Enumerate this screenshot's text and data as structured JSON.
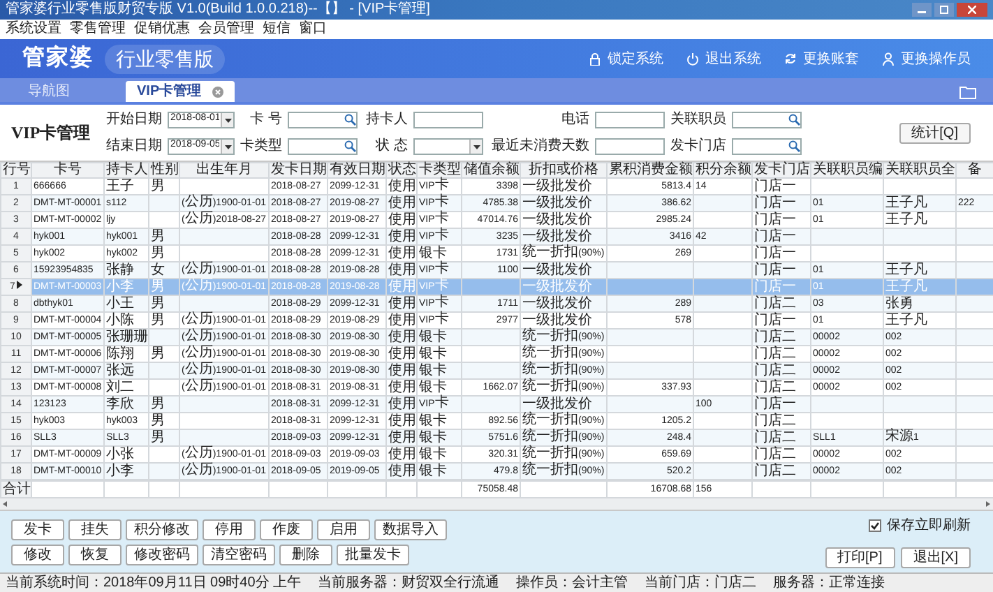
{
  "window": {
    "title": "管家婆行业零售版财贸专版 V1.0(Build 1.0.0.218)--【】 - [VIP卡管理]"
  },
  "menu": [
    "系统设置",
    "零售管理",
    "促销优惠",
    "会员管理",
    "短信",
    "窗口"
  ],
  "banner": {
    "logo": "管家婆",
    "edition": "行业零售版",
    "actions": [
      {
        "kind": "lock",
        "label": "锁定系统"
      },
      {
        "kind": "power",
        "label": "退出系统"
      },
      {
        "kind": "refresh",
        "label": "更换账套"
      },
      {
        "kind": "user",
        "label": "更换操作员"
      }
    ]
  },
  "tabs": [
    {
      "label": "导航图",
      "selected": false
    },
    {
      "label": "VIP卡管理",
      "selected": true
    }
  ],
  "filter": {
    "title": "VIP卡管理",
    "fields": [
      {
        "label": "开始日期",
        "kind": "date",
        "value": "2018-08-01"
      },
      {
        "label": "卡 号",
        "kind": "search"
      },
      {
        "label": "持卡人",
        "kind": "text"
      },
      {
        "label": "电话",
        "kind": "text"
      },
      {
        "label": "关联职员",
        "kind": "search"
      },
      {
        "label": "结束日期",
        "kind": "date",
        "value": "2018-09-05"
      },
      {
        "label": "卡类型",
        "kind": "search"
      },
      {
        "label": "状 态",
        "kind": "select"
      },
      {
        "label": "最近未消费天数",
        "kind": "text"
      },
      {
        "label": "发卡门店",
        "kind": "search"
      }
    ],
    "stats_button": "统计[Q]"
  },
  "table": {
    "columns": [
      {
        "label": "行号"
      },
      {
        "label": "卡号"
      },
      {
        "label": "持卡人"
      },
      {
        "label": "性别"
      },
      {
        "label": "出生年月"
      },
      {
        "label": "发卡日期"
      },
      {
        "label": "有效日期"
      },
      {
        "label": "状态"
      },
      {
        "label": "卡类型"
      },
      {
        "label": "储值余额",
        "numeric": true
      },
      {
        "label": "折扣或价格"
      },
      {
        "label": "累积消费金额",
        "numeric": true
      },
      {
        "label": "积分余额"
      },
      {
        "label": "发卡门店"
      },
      {
        "label": "关联职员编"
      },
      {
        "label": "关联职员全"
      },
      {
        "label": "备"
      }
    ],
    "rows": [
      {
        "selected": false,
        "cells": [
          "1",
          "666666",
          "王子",
          "男",
          null,
          "2018-08-27",
          "2099-12-31",
          "使用",
          "VIP卡",
          "3398",
          "一级批发价",
          "5813.4",
          "14",
          "门店一",
          null,
          null,
          null
        ]
      },
      {
        "selected": false,
        "cells": [
          "2",
          "DMT-MT-00001",
          "s112",
          null,
          "(公历)1900-01-01",
          "2018-08-27",
          "2019-08-27",
          "使用",
          "VIP卡",
          "4785.38",
          "一级批发价",
          "386.62",
          null,
          "门店一",
          "01",
          "王子凡",
          "222"
        ]
      },
      {
        "selected": false,
        "cells": [
          "3",
          "DMT-MT-00002",
          "ljy",
          null,
          "(公历)2018-08-27",
          "2018-08-27",
          "2019-08-27",
          "使用",
          "VIP卡",
          "47014.76",
          "一级批发价",
          "2985.24",
          null,
          "门店一",
          "01",
          "王子凡",
          null
        ]
      },
      {
        "selected": false,
        "cells": [
          "4",
          "hyk001",
          "hyk001",
          "男",
          null,
          "2018-08-28",
          "2099-12-31",
          "使用",
          "VIP卡",
          "3235",
          "一级批发价",
          "3416",
          "42",
          "门店一",
          null,
          null,
          null
        ]
      },
      {
        "selected": false,
        "cells": [
          "5",
          "hyk002",
          "hyk002",
          "男",
          null,
          "2018-08-28",
          "2099-12-31",
          "使用",
          "银卡",
          "1731",
          "统一折扣(90%)",
          "269",
          null,
          "门店一",
          null,
          null,
          null
        ]
      },
      {
        "selected": false,
        "cells": [
          "6",
          "15923954835",
          "张静",
          "女",
          "(公历)1900-01-01",
          "2018-08-28",
          "2019-08-28",
          "使用",
          "VIP卡",
          "1100",
          "一级批发价",
          null,
          null,
          "门店一",
          "01",
          "王子凡",
          null
        ]
      },
      {
        "selected": true,
        "cells": [
          "7",
          "DMT-MT-00003",
          "小李",
          "男",
          "(公历)1900-01-01",
          "2018-08-28",
          "2019-08-28",
          "使用",
          "VIP卡",
          null,
          "一级批发价",
          null,
          null,
          "门店一",
          "01",
          "王子凡",
          null
        ]
      },
      {
        "selected": false,
        "cells": [
          "8",
          "dbthyk01",
          "小王",
          "男",
          null,
          "2018-08-29",
          "2099-12-31",
          "使用",
          "VIP卡",
          "1711",
          "一级批发价",
          "289",
          null,
          "门店二",
          "03",
          "张勇",
          null
        ]
      },
      {
        "selected": false,
        "cells": [
          "9",
          "DMT-MT-00004",
          "小陈",
          "男",
          "(公历)1900-01-01",
          "2018-08-29",
          "2019-08-29",
          "使用",
          "VIP卡",
          "2977",
          "一级批发价",
          "578",
          null,
          "门店一",
          "01",
          "王子凡",
          null
        ]
      },
      {
        "selected": false,
        "cells": [
          "10",
          "DMT-MT-00005",
          "张珊珊",
          null,
          "(公历)1900-01-01",
          "2018-08-30",
          "2019-08-30",
          "使用",
          "银卡",
          null,
          "统一折扣(90%)",
          null,
          null,
          "门店二",
          "00002",
          "002",
          null
        ]
      },
      {
        "selected": false,
        "cells": [
          "11",
          "DMT-MT-00006",
          "陈翔",
          "男",
          "(公历)1900-01-01",
          "2018-08-30",
          "2019-08-30",
          "使用",
          "银卡",
          null,
          "统一折扣(90%)",
          null,
          null,
          "门店二",
          "00002",
          "002",
          null
        ]
      },
      {
        "selected": false,
        "cells": [
          "12",
          "DMT-MT-00007",
          "张远",
          null,
          "(公历)1900-01-01",
          "2018-08-30",
          "2019-08-30",
          "使用",
          "银卡",
          null,
          "统一折扣(90%)",
          null,
          null,
          "门店二",
          "00002",
          "002",
          null
        ]
      },
      {
        "selected": false,
        "cells": [
          "13",
          "DMT-MT-00008",
          "刘二",
          null,
          "(公历)1900-01-01",
          "2018-08-31",
          "2019-08-31",
          "使用",
          "银卡",
          "1662.07",
          "统一折扣(90%)",
          "337.93",
          null,
          "门店二",
          "00002",
          "002",
          null
        ]
      },
      {
        "selected": false,
        "cells": [
          "14",
          "123123",
          "李欣",
          "男",
          null,
          "2018-08-31",
          "2099-12-31",
          "使用",
          "VIP卡",
          null,
          "一级批发价",
          null,
          "100",
          "门店一",
          null,
          null,
          null
        ]
      },
      {
        "selected": false,
        "cells": [
          "15",
          "hyk003",
          "hyk003",
          "男",
          null,
          "2018-08-31",
          "2099-12-31",
          "使用",
          "银卡",
          "892.56",
          "统一折扣(90%)",
          "1205.2",
          null,
          "门店二",
          null,
          null,
          null
        ]
      },
      {
        "selected": false,
        "cells": [
          "16",
          "SLL3",
          "SLL3",
          "男",
          null,
          "2018-09-03",
          "2099-12-31",
          "使用",
          "银卡",
          "5751.6",
          "统一折扣(90%)",
          "248.4",
          null,
          "门店二",
          "SLL1",
          "宋源1",
          null
        ]
      },
      {
        "selected": false,
        "cells": [
          "17",
          "DMT-MT-00009",
          "小张",
          null,
          "(公历)1900-01-01",
          "2018-09-03",
          "2019-09-03",
          "使用",
          "银卡",
          "320.31",
          "统一折扣(90%)",
          "659.69",
          null,
          "门店二",
          "00002",
          "002",
          null
        ]
      },
      {
        "selected": false,
        "cells": [
          "18",
          "DMT-MT-00010",
          "小李",
          null,
          "(公历)1900-01-01",
          "2018-09-05",
          "2019-09-05",
          "使用",
          "银卡",
          "479.8",
          "统一折扣(90%)",
          "520.2",
          null,
          "门店二",
          "00002",
          "002",
          null
        ]
      }
    ],
    "total": {
      "label": "合计",
      "cells": [
        null,
        null,
        null,
        null,
        null,
        null,
        null,
        null,
        "75058.48",
        null,
        "16708.68",
        "156",
        null,
        null,
        null,
        null
      ]
    }
  },
  "actions": {
    "row_1": [
      "发卡",
      "挂失",
      "积分修改",
      "停用",
      "作废",
      "启用",
      "数据导入"
    ],
    "row_2": [
      "修改",
      "恢复",
      "修改密码",
      "清空密码",
      "删除",
      "批量发卡"
    ],
    "refresh_on_save": {
      "label": "保存立即刷新",
      "checked": true
    },
    "print": "打印[P]",
    "exit": "退出[X]"
  },
  "status_bar": [
    "当前系统时间：2018年09月11日 09时40分 上午",
    "当前服务器：财贸双全行流通",
    "操作员：会计主管",
    "当前门店：门店二",
    "服务器：正常连接"
  ]
}
